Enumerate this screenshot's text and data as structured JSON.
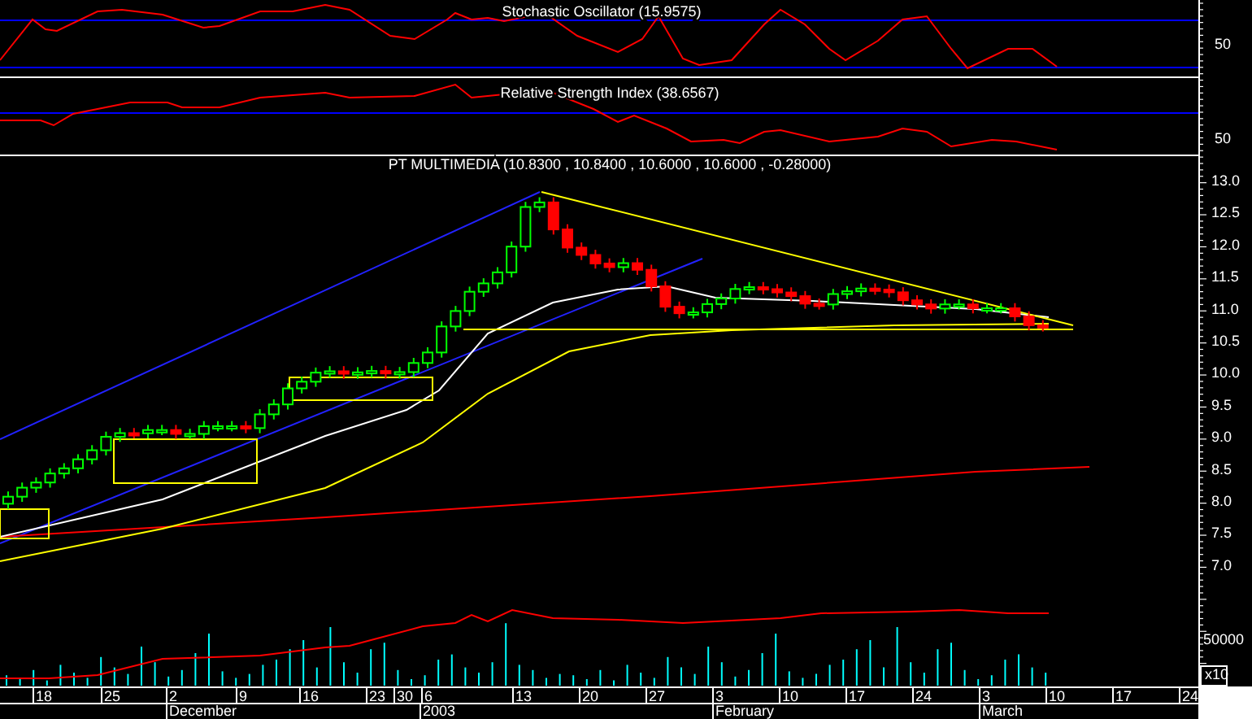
{
  "stochastic": {
    "title": "Stochastic Oscillator (15.9575)",
    "yticks": [
      "50"
    ]
  },
  "rsi": {
    "title": "Relative Strength Index (38.6567)",
    "yticks": [
      "50"
    ]
  },
  "price": {
    "title": "PT MULTIMEDIA (10.8300 , 10.8400 , 10.6000 , 10.6000 , -0.28000)",
    "yticks": [
      "13.0",
      "12.5",
      "12.0",
      "11.5",
      "11.0",
      "10.5",
      "10.0",
      "9.5",
      "9.0",
      "8.5",
      "8.0",
      "7.5",
      "7.0"
    ]
  },
  "volume": {
    "yticks": [
      "50000"
    ],
    "scale": "x10"
  },
  "x_axis": {
    "days": [
      "18",
      "25",
      "2",
      "9",
      "16",
      "23",
      "30",
      "6",
      "13",
      "20",
      "27",
      "3",
      "10",
      "17",
      "24",
      "3",
      "10",
      "17",
      "24"
    ],
    "months": [
      "December",
      "2003",
      "February",
      "March"
    ]
  }
}
